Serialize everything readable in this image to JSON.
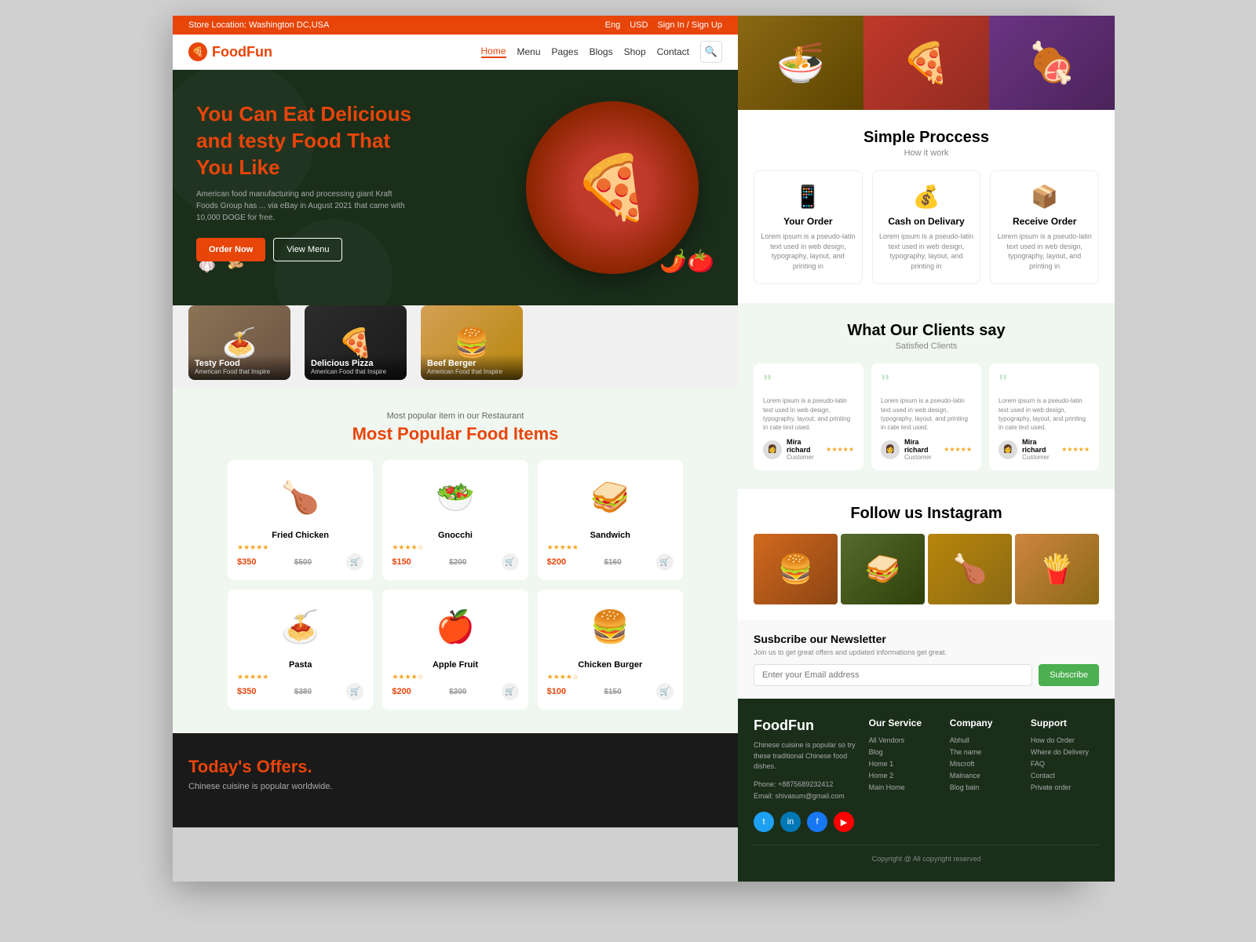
{
  "topbar": {
    "store": "Store Location: Washington DC,USA",
    "lang": "Eng",
    "currency": "USD",
    "auth": "Sign In / Sign Up"
  },
  "nav": {
    "brand": "FoodFun",
    "links": [
      "Home",
      "Menu",
      "Pages",
      "Blogs",
      "Shop",
      "Contact"
    ]
  },
  "hero": {
    "line1": "You Can Eat Delicious",
    "line2": "and testy Food That",
    "highlight": "You Like",
    "desc": "American food manufacturing and processing giant Kraft Foods Group has ... via eBay in August 2021 that came with 10,000 DOGE for free.",
    "btn_order": "Order Now",
    "btn_menu": "View Menu"
  },
  "food_strip": [
    {
      "name": "Testy Food",
      "sub": "American Food that Inspire",
      "emoji": "🍝"
    },
    {
      "name": "Delicious Pizza",
      "sub": "American Food that Inspire",
      "emoji": "🍕"
    },
    {
      "name": "Beef Berger",
      "sub": "American Food that Inspire",
      "emoji": "🍔"
    }
  ],
  "popular": {
    "subtitle": "Most popular item in our Restaurant",
    "title": "Most Popular ",
    "title_highlight": "Food Items",
    "items": [
      {
        "name": "Fried Chicken",
        "price": "$350",
        "old_price": "$500",
        "stars": "★★★★★",
        "emoji": "🍗"
      },
      {
        "name": "Gnocchi",
        "price": "$150",
        "old_price": "$200",
        "stars": "★★★★☆",
        "emoji": "🥗"
      },
      {
        "name": "Sandwich",
        "price": "$200",
        "old_price": "$160",
        "stars": "★★★★★",
        "emoji": "🥪"
      },
      {
        "name": "Pasta",
        "price": "$350",
        "old_price": "$380",
        "stars": "★★★★★",
        "emoji": "🍝"
      },
      {
        "name": "Apple Fruit",
        "price": "$200",
        "old_price": "$300",
        "stars": "★★★★☆",
        "emoji": "🍎"
      },
      {
        "name": "Chicken Burger",
        "price": "$100",
        "old_price": "$150",
        "stars": "★★★★☆",
        "emoji": "🍔"
      }
    ]
  },
  "offers": {
    "title": "Today's ",
    "highlight": "Offers.",
    "desc": "Chinese cuisine is popular worldwide."
  },
  "process": {
    "title": "Simple Proccess",
    "subtitle": "How it work",
    "steps": [
      {
        "title": "Your Order",
        "desc": "Lorem ipsum is a pseudo-latin text used in web design, typography, layout, and printing in",
        "emoji": "📱"
      },
      {
        "title": "Cash on Delivary",
        "desc": "Lorem ipsum is a pseudo-latin text used in web design, typography, layout, and printing in",
        "emoji": "💰"
      },
      {
        "title": "Receive Order",
        "desc": "Lorem ipsum is a pseudo-latin text used in web design, typography, layout, and printing in",
        "emoji": "📦"
      }
    ]
  },
  "clients": {
    "title": "What Our Clients say",
    "subtitle": "Satisfied Clients",
    "reviews": [
      {
        "text": "Lorem ipsum is a pseudo-latin text used in web design, typography, layout, and printing in cate text used.",
        "name": "Mira richard",
        "role": "Customer",
        "stars": "★★★★★",
        "avatar": "👩"
      },
      {
        "text": "Lorem ipsum is a pseudo-latin text used in web design, typography, layout, and printing in cate text used.",
        "name": "Mira richard",
        "role": "Customer",
        "stars": "★★★★★",
        "avatar": "👩"
      },
      {
        "text": "Lorem ipsum is a pseudo-latin text used in web design, typography, layout, and printing in cate text used.",
        "name": "Mira richard",
        "role": "Customer",
        "stars": "★★★★★",
        "avatar": "👩"
      }
    ]
  },
  "instagram": {
    "title": "Follow us Instagram"
  },
  "newsletter": {
    "title": "Susbcribe our Newsletter",
    "desc": "Join us to get great offers and updated informations get great.",
    "placeholder": "Enter your Email address",
    "btn": "Subscribe"
  },
  "footer": {
    "brand": "FoodFun",
    "desc": "Chinese cuisine is popular so try these traditional Chinese food dishes.",
    "phone": "Phone: +8875689232412",
    "email": "Email: shivasum@gmail.com",
    "services": {
      "title": "Our Service",
      "items": [
        "All Vendors",
        "Blog",
        "Home 1",
        "Home 2",
        "Main Home"
      ]
    },
    "company": {
      "title": "Company",
      "items": [
        "Abhull",
        "The name",
        "Miscroft",
        "Malnance",
        "Blog bain"
      ]
    },
    "support": {
      "title": "Support",
      "items": [
        "How do Order",
        "Where do Delivery",
        "FAQ",
        "Contact",
        "Private order"
      ]
    },
    "copyright": "Copyright @ All copyright reserved"
  }
}
